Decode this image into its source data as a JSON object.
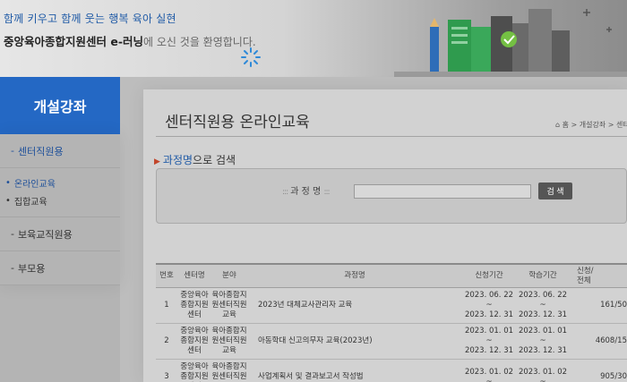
{
  "header": {
    "tagline": "함께 키우고 함께 웃는 행복 육아 실현",
    "welcome_brand": "중앙육아종합지원센터 e-러닝",
    "welcome_rest": "에 오신 것을 환영합니다."
  },
  "sidebar": {
    "title": "개설강좌",
    "items": [
      {
        "label": "센터직원용",
        "active": true
      },
      {
        "label": "보육교직원용"
      },
      {
        "label": "부모용"
      }
    ],
    "subitems": [
      {
        "label": "온라인교육",
        "active": true
      },
      {
        "label": "집합교육"
      }
    ],
    "dash": "-",
    "dot": "•"
  },
  "main": {
    "page_title": "센터직원용 온라인교육",
    "breadcrumb": "⌂ 홈 > 개설강좌 > 센터직",
    "search_heading_arrow": "▶",
    "search_heading_highlight": "과정명",
    "search_heading_rest": "으로 검색",
    "search_field_deco_left": ":::",
    "search_field_label": "과 정 명",
    "search_field_deco_right": ":::",
    "search_value": "",
    "search_button": "검 색"
  },
  "table": {
    "headers": {
      "no": "번호",
      "center": "센터명",
      "field": "분야",
      "course": "과정명",
      "apply": "신청기간",
      "learn": "학습기간",
      "count_1": "신청/",
      "count_2": "전체"
    },
    "tilde": "~",
    "rows": [
      {
        "no": "1",
        "center": "중앙육아종합지원센터",
        "field": "육아종합지원센터직원교육",
        "course": "2023년 대체교사관리자 교육",
        "apply_start": "2023. 06. 22",
        "apply_end": "2023. 12. 31",
        "learn_start": "2023. 06. 22",
        "learn_end": "2023. 12. 31",
        "count": "161/50"
      },
      {
        "no": "2",
        "center": "중앙육아종합지원센터",
        "field": "육아종합지원센터직원교육",
        "course": "아동학대 신고의무자 교육(2023년)",
        "apply_start": "2023. 01. 01",
        "apply_end": "2023. 12. 31",
        "learn_start": "2023. 01. 01",
        "learn_end": "2023. 12. 31",
        "count": "4608/15"
      },
      {
        "no": "3",
        "center": "중앙육아종합지원센터",
        "field": "육아종합지원센터직원교육",
        "course": "사업계획서 및 결과보고서 작성법",
        "apply_start": "2023. 01. 02",
        "apply_end": "",
        "learn_start": "2023. 01. 02",
        "learn_end": "",
        "count": "905/30"
      }
    ]
  },
  "colors": {
    "brand_blue": "#2468c4",
    "heading_blue": "#1f5aa6",
    "accent_red": "#c2452a"
  }
}
